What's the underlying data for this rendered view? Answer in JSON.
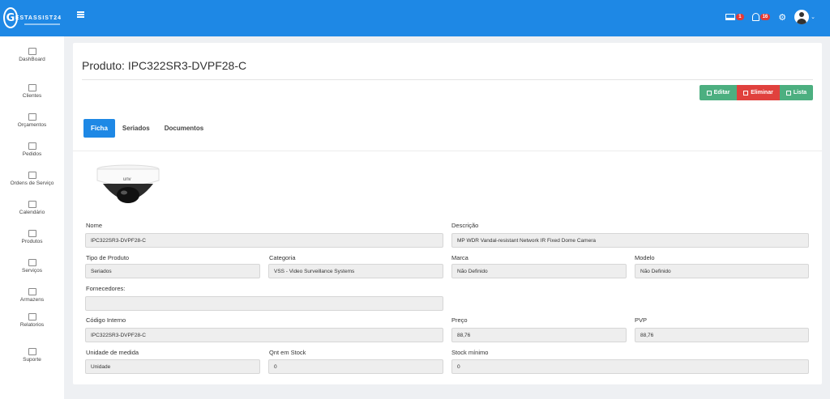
{
  "app": {
    "logo_letter": "G",
    "logo_text": "ESTASSIST24",
    "badge_screen": "1",
    "badge_bell": "16"
  },
  "sidebar": {
    "items": [
      {
        "label": "DashBoard",
        "icon": "chart-icon"
      },
      {
        "label": "Clientes",
        "icon": "users-icon"
      },
      {
        "label": "Orçamentos",
        "icon": "money-icon"
      },
      {
        "label": "Pedidos",
        "icon": "cart-icon"
      },
      {
        "label": "Ordens de Serviço",
        "icon": "wrench-icon"
      },
      {
        "label": "Calendário",
        "icon": "calendar-icon"
      },
      {
        "label": "Produtos",
        "icon": "box-icon"
      },
      {
        "label": "Serviços",
        "icon": "service-icon"
      },
      {
        "label": "Armazens",
        "icon": "warehouse-icon"
      },
      {
        "label": "Relatorios",
        "icon": "report-icon"
      },
      {
        "label": "Suporte",
        "icon": "support-icon"
      }
    ]
  },
  "page": {
    "title": "Produto: IPC322SR3-DVPF28-C",
    "buttons": {
      "edit": "Editar",
      "delete": "Eliminar",
      "list": "Lista"
    },
    "tabs": [
      "Ficha",
      "Seriados",
      "Documentos"
    ],
    "active_tab": "Ficha"
  },
  "fields": {
    "nome": {
      "label": "Nome",
      "value": "IPC322SR3-DVPF28-C"
    },
    "descricao": {
      "label": "Descrição",
      "value": "MP WDR Vandal-resistant Network IR Fixed Dome Camera"
    },
    "tipo": {
      "label": "Tipo de Produto",
      "value": "Seriados"
    },
    "categoria": {
      "label": "Categoria",
      "value": "VSS - Video Surveillance Systems"
    },
    "marca": {
      "label": "Marca",
      "value": "Não Definido"
    },
    "modelo": {
      "label": "Modelo",
      "value": "Não Definido"
    },
    "fornecedores": {
      "label": "Fornecedores:",
      "value": ""
    },
    "codigo": {
      "label": "Código Interno",
      "value": "IPC322SR3-DVPF28-C"
    },
    "preco": {
      "label": "Preço",
      "value": "88,76"
    },
    "pvp": {
      "label": "PVP",
      "value": "88,76"
    },
    "unidade": {
      "label": "Unidade de medida",
      "value": "Unidade"
    },
    "stock": {
      "label": "Qnt em Stock",
      "value": "0"
    },
    "stock_min": {
      "label": "Stock mínimo",
      "value": "0"
    }
  },
  "product_image": {
    "brand_text": "unv"
  }
}
